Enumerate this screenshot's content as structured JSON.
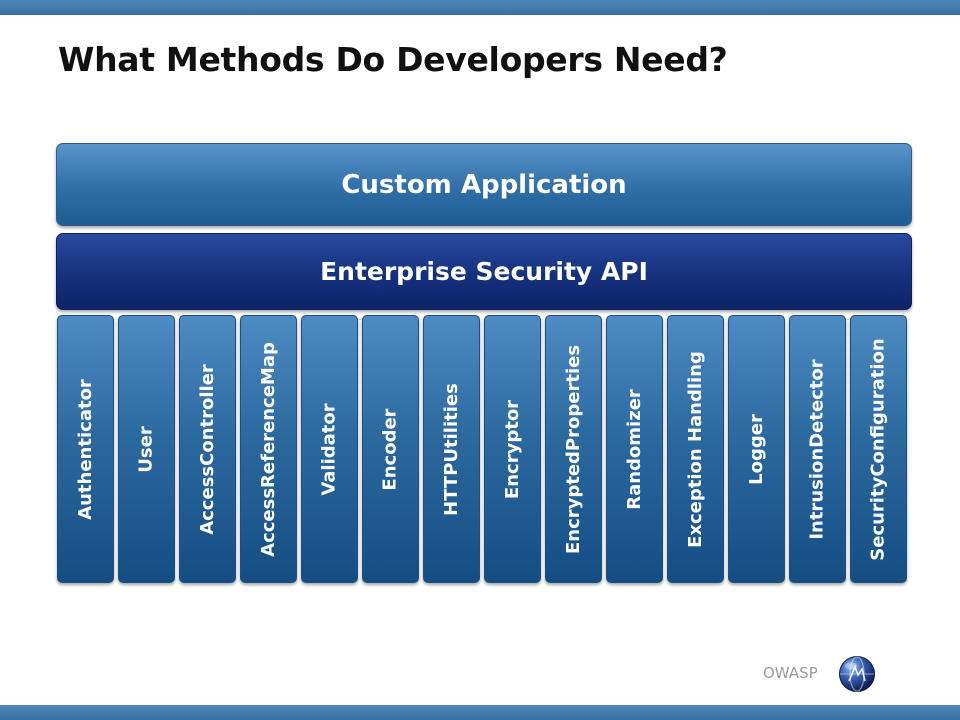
{
  "slide": {
    "title": "What Methods Do Developers Need?"
  },
  "layers": {
    "application": "Custom Application",
    "esapi": "Enterprise Security API"
  },
  "components": [
    "Authenticator",
    "User",
    "AccessController",
    "AccessReferenceMap",
    "Validator",
    "Encoder",
    "HTTPUtilities",
    "Encryptor",
    "EncryptedProperties",
    "Randomizer",
    "Exception Handling",
    "Logger",
    "IntrusionDetector",
    "SecurityConfiguration"
  ],
  "footer": {
    "brand": "OWASP",
    "logo_icon": "owasp-globe-icon"
  },
  "colors": {
    "bar": "#3f77a9",
    "application_layer": "#2f6ea6",
    "esapi_layer": "#15317e",
    "component_column": "#2c699f"
  }
}
